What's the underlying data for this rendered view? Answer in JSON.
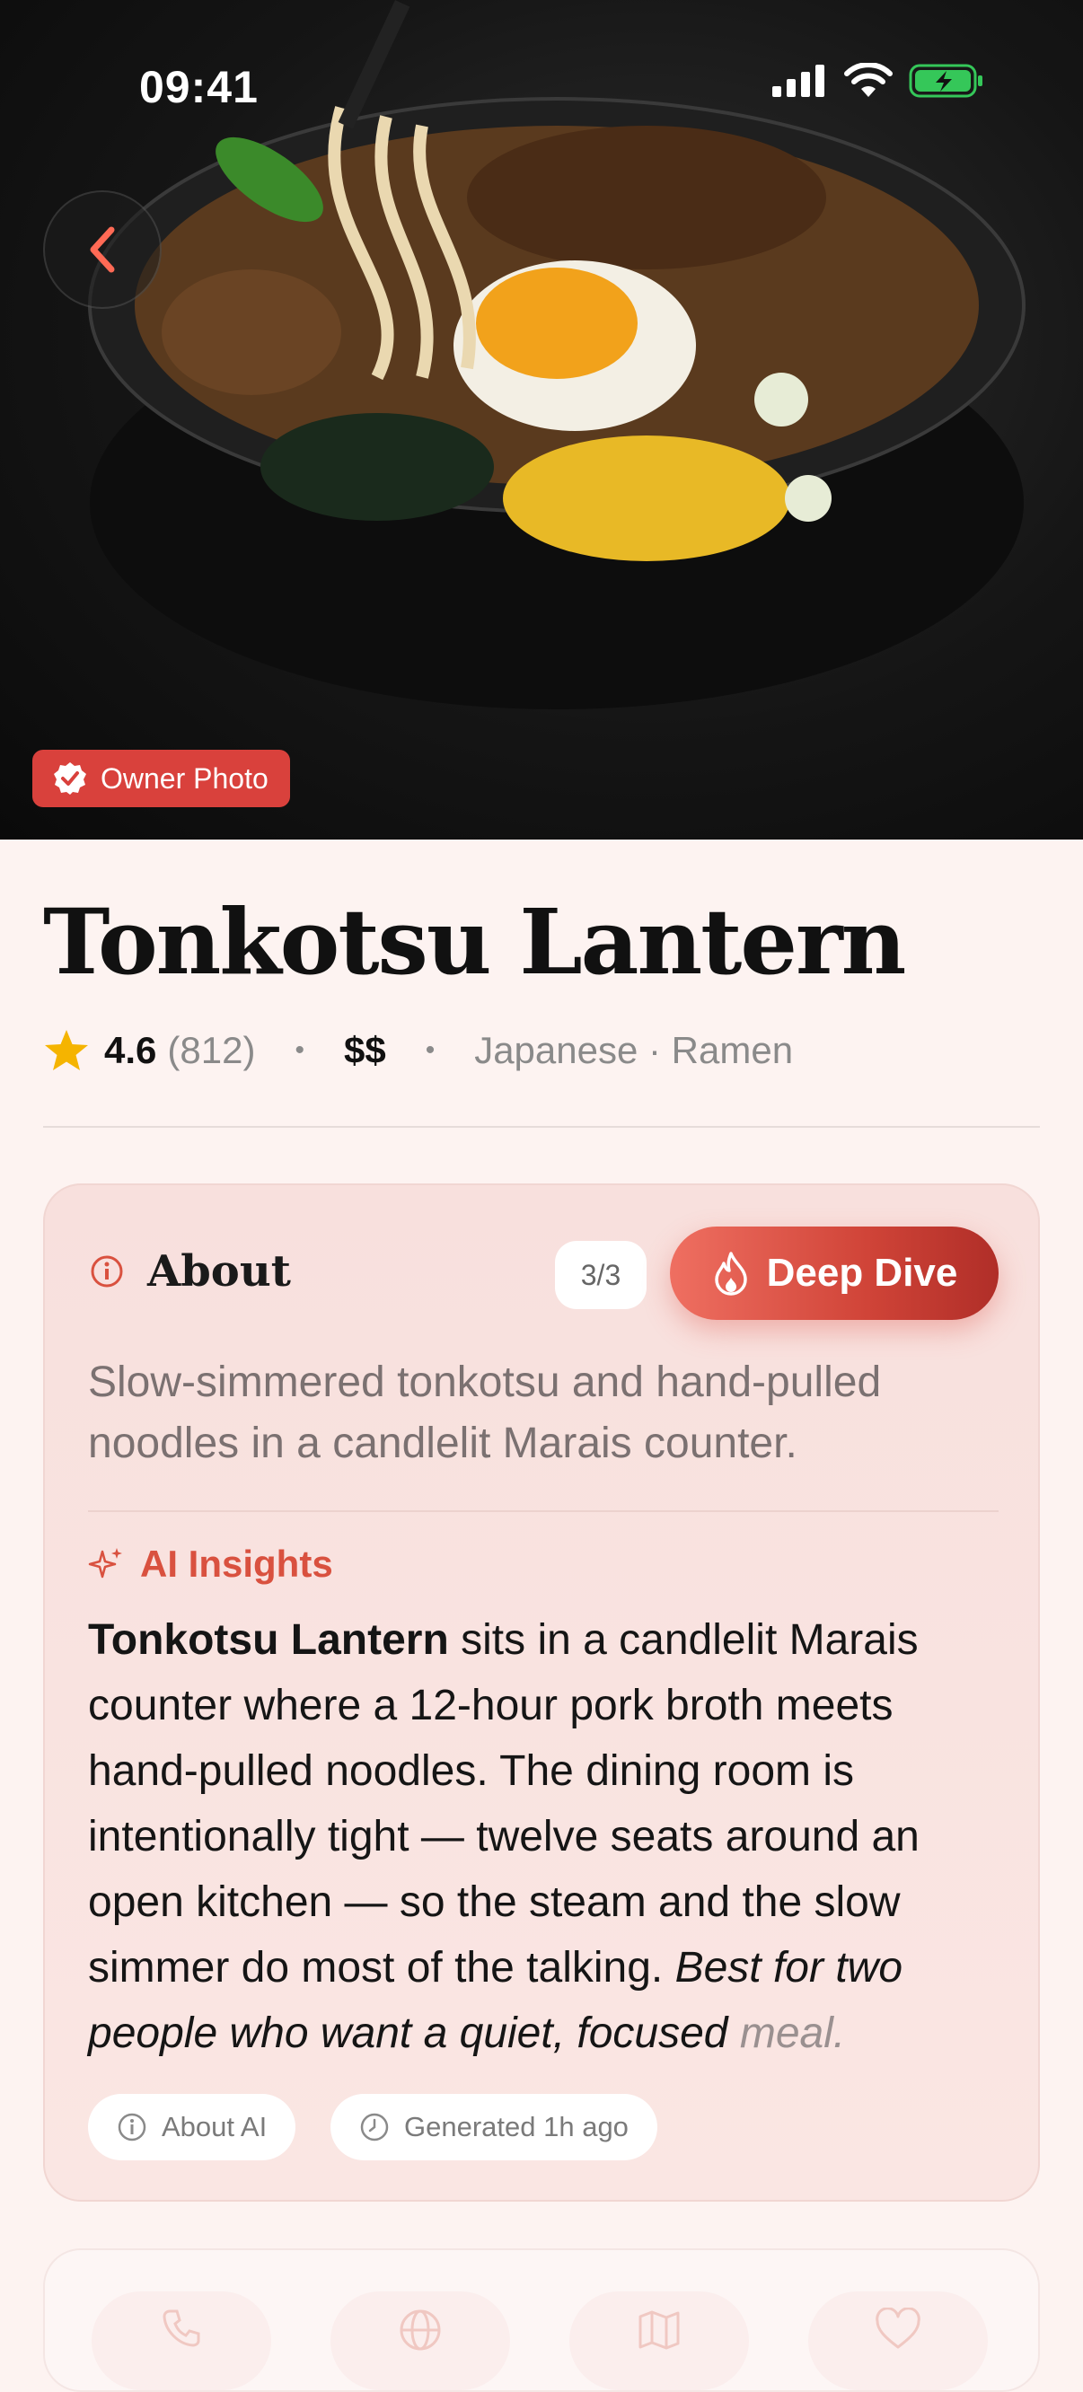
{
  "status": {
    "time": "09:41"
  },
  "hero": {
    "badge_label": "Owner Photo"
  },
  "restaurant": {
    "name": "Tonkotsu Lantern",
    "rating": "4.6",
    "review_count": "(812)",
    "price": "$$",
    "cuisine": "Japanese · Ramen",
    "rating_fraction": 0.92
  },
  "about": {
    "title": "About",
    "page_counter": "3/3",
    "deep_dive_label": "Deep Dive",
    "description": "Slow-simmered tonkotsu and hand-pulled noodles in a candlelit Marais counter.",
    "ai_title": "AI Insights",
    "ai_bold": "Tonkotsu Lantern",
    "ai_text": " sits in a candlelit Marais counter where a 12-hour pork broth meets hand-pulled noodles. The dining room is intentionally tight — twelve seats around an open kitchen — so the steam and the slow simmer do most of the talking. ",
    "ai_italic": "Best for two people who want a quiet, focused",
    "ai_italic_fade": " meal.",
    "chip_about": "About AI",
    "chip_generated": "Generated 1h ago"
  },
  "actions": [
    "phone-icon",
    "globe-icon",
    "map-icon",
    "heart-icon"
  ],
  "colors": {
    "accent": "#d9413c",
    "star": "#f5b400"
  }
}
